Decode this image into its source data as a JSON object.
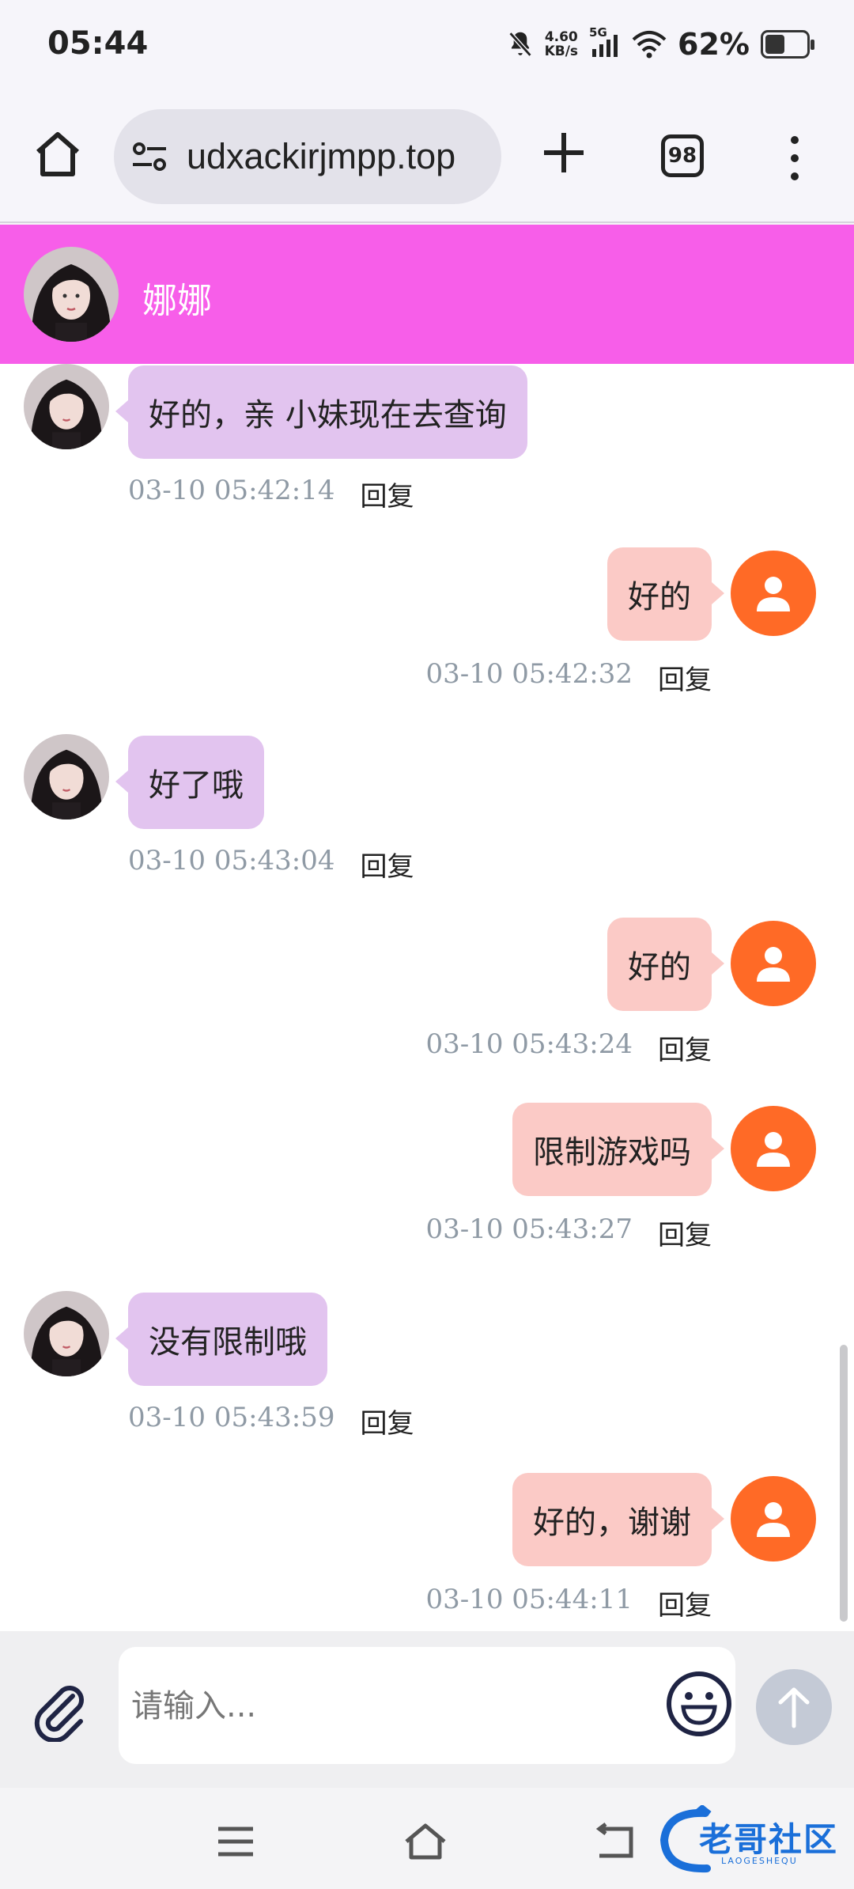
{
  "status_bar": {
    "time": "05:44",
    "net_speed_value": "4.60",
    "net_speed_unit": "KB/s",
    "network": "5G",
    "battery": "62%"
  },
  "browser": {
    "url": "udxackirjmpp.top",
    "tab_count": "98"
  },
  "chat": {
    "contact_name": "娜娜",
    "messages": [
      {
        "side": "left",
        "text": "好的，亲 小妹现在去查询",
        "time": "03-10 05:42:14",
        "reply": "回复"
      },
      {
        "side": "right",
        "text": "好的",
        "time": "03-10 05:42:32",
        "reply": "回复"
      },
      {
        "side": "left",
        "text": "好了哦",
        "time": "03-10 05:43:04",
        "reply": "回复"
      },
      {
        "side": "right",
        "text": "好的",
        "time": "03-10 05:43:24",
        "reply": "回复"
      },
      {
        "side": "right",
        "text": "限制游戏吗",
        "time": "03-10 05:43:27",
        "reply": "回复"
      },
      {
        "side": "left",
        "text": "没有限制哦",
        "time": "03-10 05:43:59",
        "reply": "回复"
      },
      {
        "side": "right",
        "text": "好的，谢谢",
        "time": "03-10 05:44:11",
        "reply": "回复"
      }
    ]
  },
  "composer": {
    "placeholder": "请输入..."
  },
  "watermark": {
    "title": "老哥社区",
    "subtitle": "LAOGESHEQU"
  },
  "colors": {
    "header": "#f75ee9",
    "bubble_left": "#e2c4ef",
    "bubble_right": "#fbcac6",
    "user_avatar": "#ff6a26"
  }
}
